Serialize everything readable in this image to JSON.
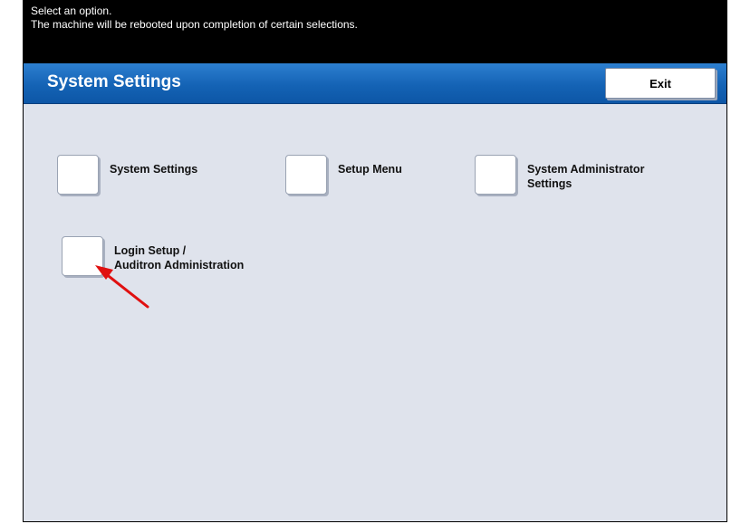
{
  "message": {
    "line1": "Select an option.",
    "line2": "The machine will be rebooted upon completion of certain selections."
  },
  "header": {
    "title": "System Settings",
    "exit_label": "Exit"
  },
  "options": [
    {
      "label": "System Settings"
    },
    {
      "label": "Setup Menu"
    },
    {
      "label": "System Administrator\nSettings"
    },
    {
      "label": "Login Setup /\nAuditron Administration"
    }
  ],
  "colors": {
    "header_blue": "#1463b5",
    "panel_background": "#dfe3ec",
    "annotation_arrow": "#e01010"
  },
  "annotation": {
    "arrow_target": "Login Setup / Auditron Administration"
  }
}
